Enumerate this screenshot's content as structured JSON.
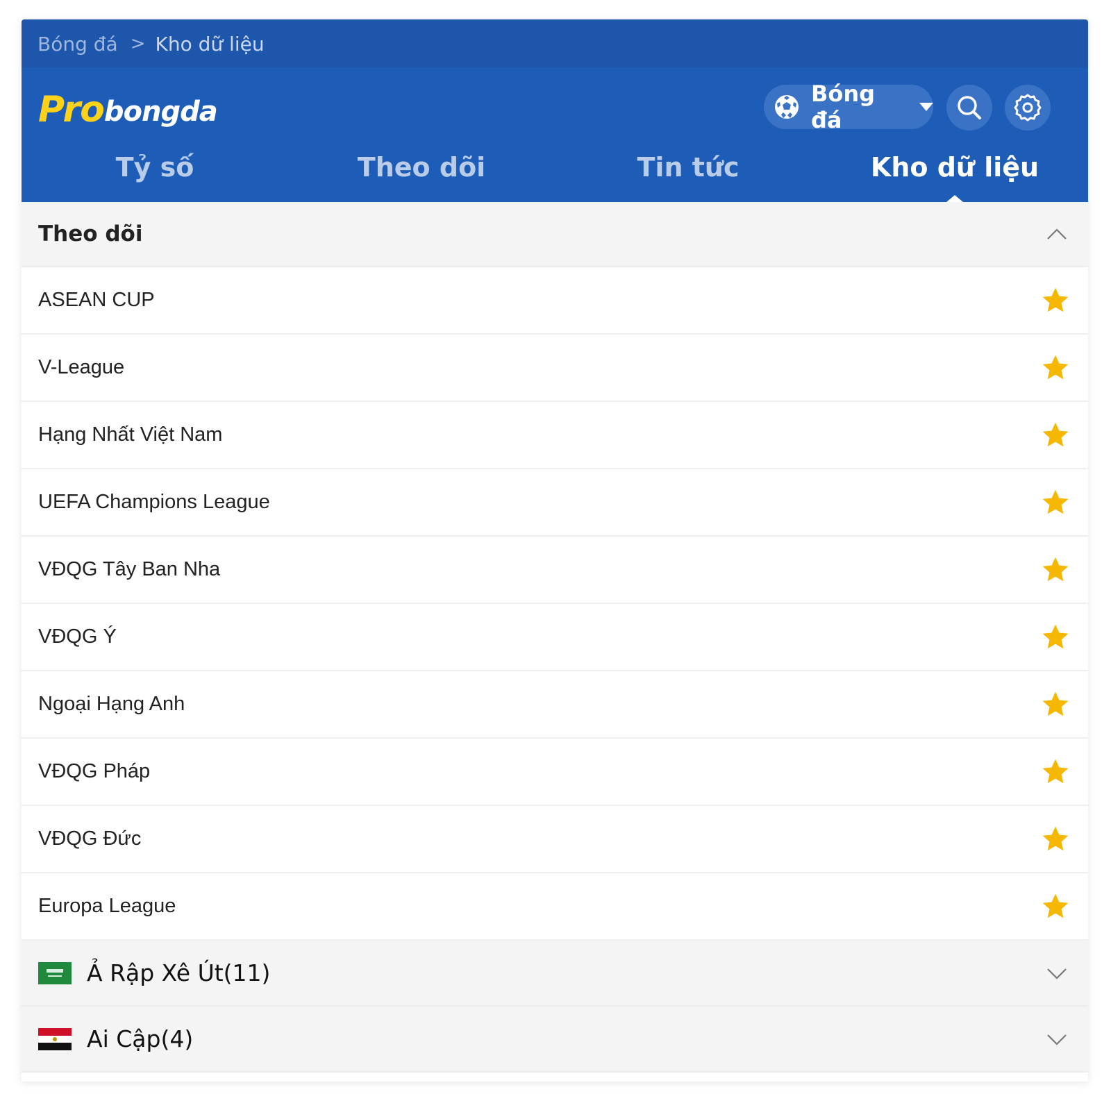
{
  "breadcrumb": {
    "root": "Bóng đá",
    "current": "Kho dữ liệu"
  },
  "logo": {
    "pro": "Pro",
    "rest": "bongda"
  },
  "sport_select": {
    "label": "Bóng đá"
  },
  "tabs": [
    {
      "label": "Tỷ số",
      "active": false
    },
    {
      "label": "Theo dõi",
      "active": false
    },
    {
      "label": "Tin tức",
      "active": false
    },
    {
      "label": "Kho dữ liệu",
      "active": true
    }
  ],
  "follow": {
    "title": "Theo dõi",
    "items": [
      {
        "label": "ASEAN CUP"
      },
      {
        "label": "V-League"
      },
      {
        "label": "Hạng Nhất Việt Nam"
      },
      {
        "label": "UEFA Champions League"
      },
      {
        "label": "VĐQG Tây Ban Nha"
      },
      {
        "label": "VĐQG Ý"
      },
      {
        "label": "Ngoại Hạng Anh"
      },
      {
        "label": "VĐQG Pháp"
      },
      {
        "label": "VĐQG Đức"
      },
      {
        "label": "Europa League"
      }
    ]
  },
  "countries": [
    {
      "label": "Ả Rập Xê Út(11)",
      "flag": "saudi-arabia-flag"
    },
    {
      "label": "Ai Cập(4)",
      "flag": "egypt-flag"
    }
  ],
  "colors": {
    "header_top": "#1d56ab",
    "header_main": "#1d5db8",
    "star": "#f5b700",
    "logo_yellow": "#ffd21a"
  }
}
